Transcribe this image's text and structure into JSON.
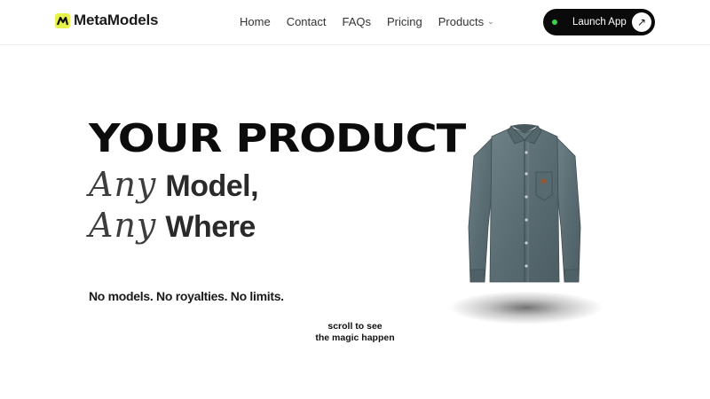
{
  "header": {
    "brand": "MetaModels",
    "nav": [
      "Home",
      "Contact",
      "FAQs",
      "Pricing",
      "Products"
    ],
    "launch_label": "Launch App"
  },
  "hero": {
    "headline": "YOUR PRODUCT",
    "line1_script": "Any",
    "line1_text": "Model,",
    "line2_script": "Any",
    "line2_text": "Where",
    "tagline": "No models. No royalties. No limits.",
    "scroll_line1": "scroll to see",
    "scroll_line2": "the magic happen"
  },
  "colors": {
    "accent_yellow": "#e8f34a",
    "status_green": "#3ad24a",
    "button_dark": "#0a0a0a",
    "denim": "#5f7278"
  },
  "icons": [
    "logo-mark-icon",
    "chevron-down-icon",
    "status-dot-icon",
    "arrow-up-right-icon"
  ]
}
